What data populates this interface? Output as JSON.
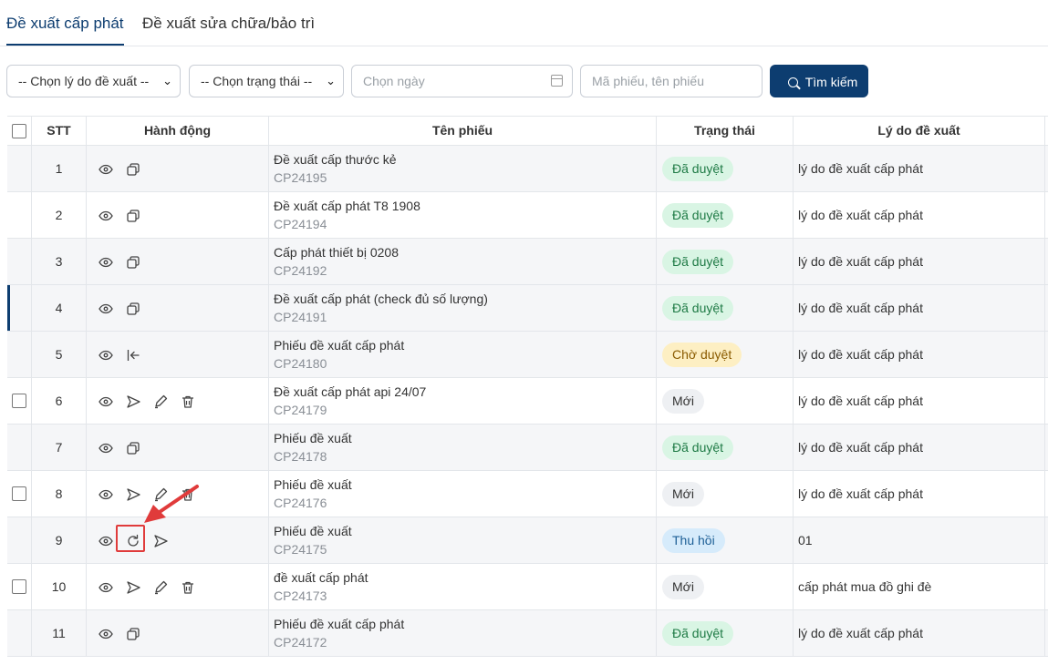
{
  "tabs": [
    {
      "label": "Đề xuất cấp phát",
      "active": true
    },
    {
      "label": "Đề xuất sửa chữa/bảo trì",
      "active": false
    }
  ],
  "filters": {
    "reason_select": "-- Chọn lý do đề xuất --",
    "status_select": "-- Chọn trạng thái --",
    "date_placeholder": "Chọn ngày",
    "keyword_placeholder": "Mã phiếu, tên phiếu",
    "search_button": "Tìm kiếm"
  },
  "table": {
    "headers": {
      "stt": "STT",
      "actions": "Hành động",
      "name": "Tên phiếu",
      "status": "Trạng thái",
      "reason": "Lý do đề xuất"
    },
    "rows": [
      {
        "stt": "1",
        "name": "Đề xuất cấp thước kẻ",
        "code": "CP24195",
        "status": "Đã duyệt",
        "reason": "lý do đề xuất cấp phát"
      },
      {
        "stt": "2",
        "name": "Đề xuất cấp phát T8 1908",
        "code": "CP24194",
        "status": "Đã duyệt",
        "reason": "lý do đề xuất cấp phát"
      },
      {
        "stt": "3",
        "name": "Cấp phát thiết bị 0208",
        "code": "CP24192",
        "status": "Đã duyệt",
        "reason": "lý do đề xuất cấp phát"
      },
      {
        "stt": "4",
        "name": "Đề xuất cấp phát (check đủ số lượng)",
        "code": "CP24191",
        "status": "Đã duyệt",
        "reason": "lý do đề xuất cấp phát"
      },
      {
        "stt": "5",
        "name": "Phiếu đề xuất cấp phát",
        "code": "CP24180",
        "status": "Chờ duyệt",
        "reason": "lý do đề xuất cấp phát"
      },
      {
        "stt": "6",
        "name": "Đề xuất cấp phát api 24/07",
        "code": "CP24179",
        "status": "Mới",
        "reason": "lý do đề xuất cấp phát"
      },
      {
        "stt": "7",
        "name": "Phiếu đề xuất",
        "code": "CP24178",
        "status": "Đã duyệt",
        "reason": "lý do đề xuất cấp phát"
      },
      {
        "stt": "8",
        "name": "Phiếu đề xuất",
        "code": "CP24176",
        "status": "Mới",
        "reason": "lý do đề xuất cấp phát"
      },
      {
        "stt": "9",
        "name": "Phiếu đề xuất",
        "code": "CP24175",
        "status": "Thu hồi",
        "reason": "01"
      },
      {
        "stt": "10",
        "name": "đề xuất cấp phát",
        "code": "CP24173",
        "status": "Mới",
        "reason": "cấp phát mua đồ ghi đè"
      },
      {
        "stt": "11",
        "name": "Phiếu đề xuất cấp phát",
        "code": "CP24172",
        "status": "Đã duyệt",
        "reason": "lý do đề xuất cấp phát"
      }
    ]
  },
  "colors": {
    "primary": "#0d3d70",
    "approved_bg": "#d9f5e4",
    "approved_fg": "#1e7a45",
    "pending_bg": "#fdefc3",
    "pending_fg": "#8a5b00",
    "new_bg": "#eef0f3",
    "new_fg": "#333333",
    "revoked_bg": "#d6ebfb",
    "revoked_fg": "#1d5f96",
    "highlight": "#e03b3b"
  }
}
